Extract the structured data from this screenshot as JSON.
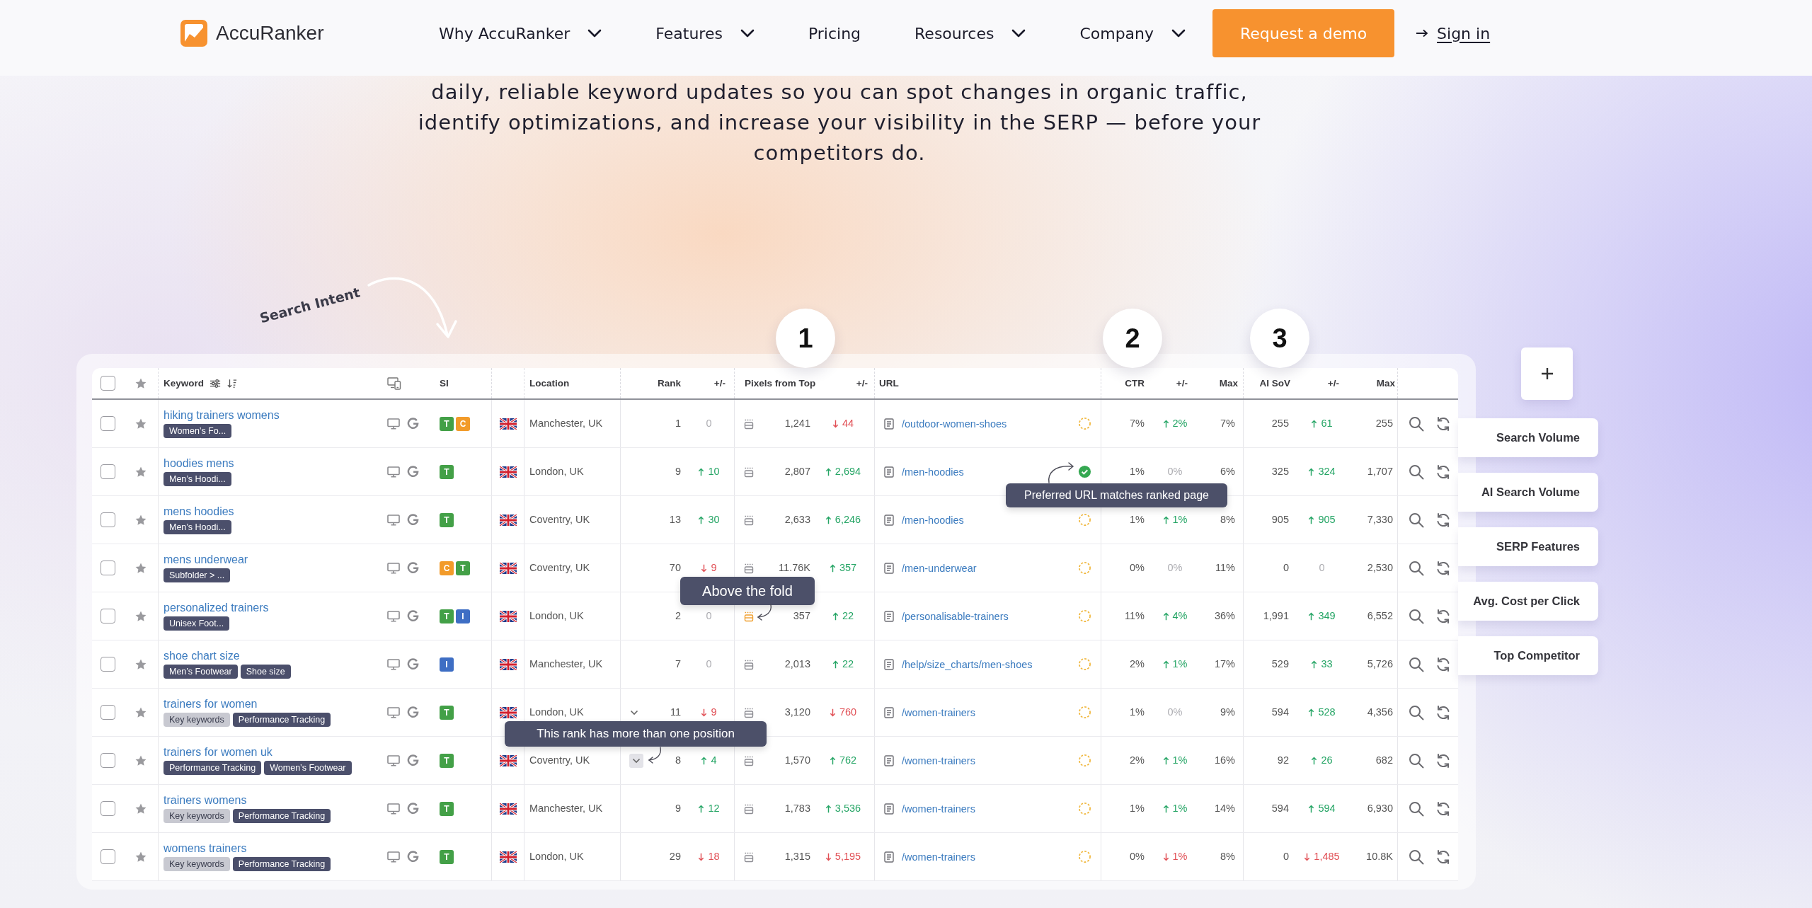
{
  "header": {
    "logo": "AccuRanker",
    "nav": [
      {
        "label": "Why AccuRanker",
        "dropdown": true
      },
      {
        "label": "Features",
        "dropdown": true
      },
      {
        "label": "Pricing",
        "dropdown": false
      },
      {
        "label": "Resources",
        "dropdown": true
      },
      {
        "label": "Company",
        "dropdown": true
      }
    ],
    "cta": "Request a demo",
    "sign_in": "Sign in"
  },
  "intro": {
    "lines": [
      "daily, reliable keyword updates so you can spot changes in organic traffic,",
      "identify optimizations, and increase your visibility in the SERP — before your",
      "competitors do."
    ]
  },
  "annotation": "Search Intent",
  "callouts": [
    "1",
    "2",
    "3"
  ],
  "table": {
    "all_checked": false,
    "columns": [
      "Keyword",
      "SI",
      "Location",
      "Rank",
      "+/-",
      "Pixels from Top",
      "+/-",
      "URL",
      "CTR",
      "+/-",
      "Max",
      "AI SoV",
      "+/-",
      "Max"
    ],
    "rows": [
      {
        "checked": false,
        "starred": false,
        "keyword": "hiking trainers womens",
        "tags": [
          {
            "label": "Women’s Fo...",
            "color": "#4b4f6b"
          }
        ],
        "si": [
          {
            "letter": "T",
            "color": "#43a047"
          },
          {
            "letter": "C",
            "color": "#f29b2a"
          }
        ],
        "location": "Manchester, UK",
        "rank": "1",
        "rank_change": {
          "kind": "none",
          "value": "0"
        },
        "above_fold": false,
        "pixels": "1,241",
        "pixels_change": {
          "kind": "down",
          "value": "44"
        },
        "url": "/outdoor-women-shoes",
        "url_match": false,
        "ctr": "7%",
        "ctr_change": {
          "kind": "up",
          "value": "2%"
        },
        "ctr_max": "7%",
        "sov": "255",
        "sov_change": {
          "kind": "up",
          "value": "61"
        },
        "sov_max": "255"
      },
      {
        "checked": false,
        "starred": false,
        "keyword": "hoodies mens",
        "tags": [
          {
            "label": "Men’s Hoodi...",
            "color": "#4b4f6b"
          }
        ],
        "si": [
          {
            "letter": "T",
            "color": "#43a047"
          }
        ],
        "location": "London, UK",
        "rank": "9",
        "rank_change": {
          "kind": "up",
          "value": "10"
        },
        "above_fold": false,
        "pixels": "2,807",
        "pixels_change": {
          "kind": "up",
          "value": "2,694"
        },
        "url": "/men-hoodies",
        "url_match": true,
        "url_tooltip": "Preferred URL matches ranked page",
        "ctr": "1%",
        "ctr_change": {
          "kind": "none",
          "value": "0%"
        },
        "ctr_max": "6%",
        "sov": "325",
        "sov_change": {
          "kind": "up",
          "value": "324"
        },
        "sov_max": "1,707"
      },
      {
        "checked": false,
        "starred": false,
        "keyword": "mens hoodies",
        "tags": [
          {
            "label": "Men’s Hoodi...",
            "color": "#4b4f6b"
          }
        ],
        "si": [
          {
            "letter": "T",
            "color": "#43a047"
          }
        ],
        "location": "Coventry, UK",
        "rank": "13",
        "rank_change": {
          "kind": "up",
          "value": "30"
        },
        "above_fold": false,
        "pixels": "2,633",
        "pixels_change": {
          "kind": "up",
          "value": "6,246"
        },
        "url": "/men-hoodies",
        "url_match": false,
        "ctr": "1%",
        "ctr_change": {
          "kind": "up",
          "value": "1%"
        },
        "ctr_max": "8%",
        "sov": "905",
        "sov_change": {
          "kind": "up",
          "value": "905"
        },
        "sov_max": "7,330"
      },
      {
        "checked": false,
        "starred": false,
        "keyword": "mens underwear",
        "tags": [
          {
            "label": "Subfolder > ...",
            "color": "#4b4f6b"
          }
        ],
        "si": [
          {
            "letter": "C",
            "color": "#f29b2a"
          },
          {
            "letter": "T",
            "color": "#43a047"
          }
        ],
        "location": "Coventry, UK",
        "rank": "70",
        "rank_change": {
          "kind": "down",
          "value": "9"
        },
        "above_fold": false,
        "pixels": "11.76K",
        "pixels_change": {
          "kind": "up",
          "value": "357"
        },
        "url": "/men-underwear",
        "url_match": false,
        "ctr": "0%",
        "ctr_change": {
          "kind": "none",
          "value": "0%"
        },
        "ctr_max": "11%",
        "sov": "0",
        "sov_change": {
          "kind": "none",
          "value": "0"
        },
        "sov_max": "2,530"
      },
      {
        "checked": false,
        "starred": false,
        "keyword": "personalized trainers",
        "tags": [
          {
            "label": "Unisex Foot...",
            "color": "#4b4f6b"
          }
        ],
        "si": [
          {
            "letter": "T",
            "color": "#43a047"
          },
          {
            "letter": "I",
            "color": "#3e6ec4"
          }
        ],
        "location": "London, UK",
        "rank": "2",
        "rank_change": {
          "kind": "none",
          "value": "0"
        },
        "above_fold": true,
        "pixels_tooltip": "Above the fold",
        "pixels": "357",
        "pixels_change": {
          "kind": "up",
          "value": "22"
        },
        "url": "/personalisable-trainers",
        "url_match": false,
        "ctr": "11%",
        "ctr_change": {
          "kind": "up",
          "value": "4%"
        },
        "ctr_max": "36%",
        "sov": "1,991",
        "sov_change": {
          "kind": "up",
          "value": "349"
        },
        "sov_max": "6,552"
      },
      {
        "checked": false,
        "starred": false,
        "keyword": "shoe chart size",
        "tags": [
          {
            "label": "Men’s Footwear",
            "color": "#4b4f6b"
          },
          {
            "label": "Shoe size",
            "color": "#4b4f6b"
          }
        ],
        "si": [
          {
            "letter": "I",
            "color": "#3e6ec4"
          }
        ],
        "location": "Manchester, UK",
        "rank": "7",
        "rank_change": {
          "kind": "none",
          "value": "0"
        },
        "above_fold": false,
        "pixels": "2,013",
        "pixels_change": {
          "kind": "up",
          "value": "22"
        },
        "url": "/help/size_charts/men-shoes",
        "url_match": false,
        "ctr": "2%",
        "ctr_change": {
          "kind": "up",
          "value": "1%"
        },
        "ctr_max": "17%",
        "sov": "529",
        "sov_change": {
          "kind": "up",
          "value": "33"
        },
        "sov_max": "5,726"
      },
      {
        "checked": false,
        "starred": false,
        "keyword": "trainers for women",
        "tags": [
          {
            "label": "Key keywords",
            "color": "#c8c9d1"
          },
          {
            "label": "Performance Tracking",
            "color": "#4b4f6b"
          }
        ],
        "si": [
          {
            "letter": "T",
            "color": "#43a047"
          }
        ],
        "location": "London, UK",
        "rank": "11",
        "rank_caret": {
          "hovered": false
        },
        "rank_change": {
          "kind": "down",
          "value": "9"
        },
        "above_fold": false,
        "pixels": "3,120",
        "pixels_change": {
          "kind": "down",
          "value": "760"
        },
        "url": "/women-trainers",
        "url_match": false,
        "ctr": "1%",
        "ctr_change": {
          "kind": "none",
          "value": "0%"
        },
        "ctr_max": "9%",
        "sov": "594",
        "sov_change": {
          "kind": "up",
          "value": "528"
        },
        "sov_max": "4,356"
      },
      {
        "checked": false,
        "starred": false,
        "keyword": "trainers for women uk",
        "tags": [
          {
            "label": "Performance Tracking",
            "color": "#4b4f6b"
          },
          {
            "label": "Women’s Footwear",
            "color": "#4b4f6b"
          }
        ],
        "si": [
          {
            "letter": "T",
            "color": "#43a047"
          }
        ],
        "location": "Coventry, UK",
        "rank": "8",
        "rank_caret": {
          "hovered": true
        },
        "rank_tooltip": "This rank has more than one position",
        "rank_change": {
          "kind": "up",
          "value": "4"
        },
        "above_fold": false,
        "pixels": "1,570",
        "pixels_change": {
          "kind": "up",
          "value": "762"
        },
        "url": "/women-trainers",
        "url_match": false,
        "ctr": "2%",
        "ctr_change": {
          "kind": "up",
          "value": "1%"
        },
        "ctr_max": "16%",
        "sov": "92",
        "sov_change": {
          "kind": "up",
          "value": "26"
        },
        "sov_max": "682"
      },
      {
        "checked": false,
        "starred": false,
        "keyword": "trainers womens",
        "tags": [
          {
            "label": "Key keywords",
            "color": "#c8c9d1"
          },
          {
            "label": "Performance Tracking",
            "color": "#4b4f6b"
          }
        ],
        "si": [
          {
            "letter": "T",
            "color": "#43a047"
          }
        ],
        "location": "Manchester, UK",
        "rank": "9",
        "rank_change": {
          "kind": "up",
          "value": "12"
        },
        "above_fold": false,
        "pixels": "1,783",
        "pixels_change": {
          "kind": "up",
          "value": "3,536"
        },
        "url": "/women-trainers",
        "url_match": false,
        "ctr": "1%",
        "ctr_change": {
          "kind": "up",
          "value": "1%"
        },
        "ctr_max": "14%",
        "sov": "594",
        "sov_change": {
          "kind": "up",
          "value": "594"
        },
        "sov_max": "6,930"
      },
      {
        "checked": false,
        "starred": false,
        "keyword": "womens trainers",
        "tags": [
          {
            "label": "Key keywords",
            "color": "#c8c9d1"
          },
          {
            "label": "Performance Tracking",
            "color": "#4b4f6b"
          }
        ],
        "si": [
          {
            "letter": "T",
            "color": "#43a047"
          }
        ],
        "location": "London, UK",
        "rank": "29",
        "rank_change": {
          "kind": "down",
          "value": "18"
        },
        "above_fold": false,
        "pixels": "1,315",
        "pixels_change": {
          "kind": "down",
          "value": "5,195"
        },
        "url": "/women-trainers",
        "url_match": false,
        "ctr": "0%",
        "ctr_change": {
          "kind": "down",
          "value": "1%"
        },
        "ctr_max": "8%",
        "sov": "0",
        "sov_change": {
          "kind": "down",
          "value": "1,485"
        },
        "sov_max": "10.8K"
      }
    ]
  },
  "side_panel": {
    "items": [
      "Search Volume",
      "AI Search Volume",
      "SERP Features",
      "Avg. Cost per Click",
      "Top Competitor"
    ]
  }
}
